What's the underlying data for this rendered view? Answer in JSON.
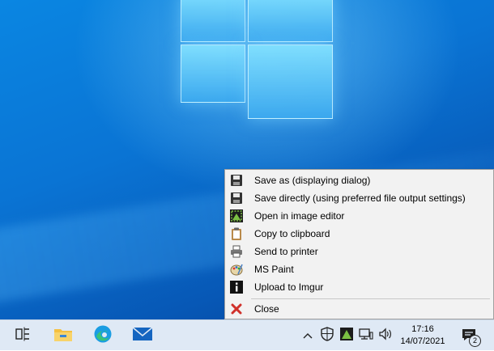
{
  "menu": {
    "items": [
      {
        "label": "Save as (displaying dialog)",
        "icon": "floppy-disk-icon"
      },
      {
        "label": "Save directly (using preferred file output settings)",
        "icon": "floppy-disk-icon"
      },
      {
        "label": "Open in image editor",
        "icon": "image-editor-icon"
      },
      {
        "label": "Copy to clipboard",
        "icon": "clipboard-icon"
      },
      {
        "label": "Send to printer",
        "icon": "printer-icon"
      },
      {
        "label": "MS Paint",
        "icon": "paint-palette-icon"
      },
      {
        "label": "Upload to Imgur",
        "icon": "imgur-info-icon"
      }
    ],
    "close_label": "Close"
  },
  "taskbar": {
    "time": "17:16",
    "date": "14/07/2021",
    "notification_count": "2"
  },
  "colors": {
    "desktop_blue": "#0a74d4",
    "menu_bg": "#f2f2f2",
    "taskbar_bg": "#dfe9f5",
    "close_red": "#d0302a"
  }
}
